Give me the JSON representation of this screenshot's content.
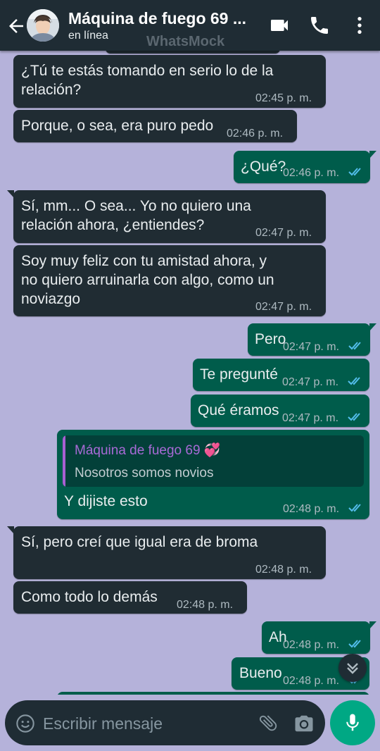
{
  "header": {
    "title": "Máquina de fuego 69 ...",
    "status": "en línea",
    "watermark": "WhatsMock"
  },
  "messages": [
    {
      "direction": "in",
      "text_lines": [
        "¿Tú te estás tomando en serio lo de la",
        "relación?"
      ],
      "time": "02:45 p. m."
    },
    {
      "direction": "in",
      "text_lines": [
        "Porque, o sea, era puro pedo"
      ],
      "time": "02:46 p. m."
    },
    {
      "direction": "out",
      "text_lines": [
        "¿Qué?"
      ],
      "time": "02:46 p. m.",
      "status": "read"
    },
    {
      "direction": "in",
      "text_lines": [
        "Sí, mm... O sea... Yo no quiero una",
        "relación ahora, ¿entiendes?"
      ],
      "time": "02:47 p. m."
    },
    {
      "direction": "in",
      "text_lines": [
        "Soy muy feliz con tu amistad ahora, y",
        "no quiero arruinarla con algo, como un",
        "noviazgo"
      ],
      "time": "02:47 p. m."
    },
    {
      "direction": "out",
      "text_lines": [
        "Pero"
      ],
      "time": "02:47 p. m.",
      "status": "read"
    },
    {
      "direction": "out",
      "text_lines": [
        "Te pregunté"
      ],
      "time": "02:47 p. m.",
      "status": "read"
    },
    {
      "direction": "out",
      "text_lines": [
        "Qué éramos"
      ],
      "time": "02:47 p. m.",
      "status": "read"
    },
    {
      "direction": "out",
      "quote": {
        "author": "Máquina de fuego 69",
        "author_emoji": "💞",
        "text": "Nosotros somos novios"
      },
      "text_lines": [
        "Y dijiste esto"
      ],
      "time": "02:48 p. m.",
      "status": "read"
    },
    {
      "direction": "in",
      "text_lines": [
        "Sí, pero creí que igual era de broma"
      ],
      "time": "02:48 p. m."
    },
    {
      "direction": "in",
      "text_lines": [
        "Como todo lo demás"
      ],
      "time": "02:48 p. m."
    },
    {
      "direction": "out",
      "text_lines": [
        "Ah"
      ],
      "time": "02:48 p. m.",
      "status": "read"
    },
    {
      "direction": "out",
      "text_lines": [
        "Bueno"
      ],
      "time": "02:48 p. m.",
      "status": "read"
    }
  ],
  "composer": {
    "placeholder": "Escribir mensaje"
  },
  "icons": {
    "back": "arrow-back-icon",
    "video": "video-call-icon",
    "call": "phone-icon",
    "menu": "more-vert-icon",
    "emoji": "emoji-icon",
    "attach": "paperclip-icon",
    "camera": "camera-icon",
    "mic": "mic-icon",
    "scroll": "double-chevron-down-icon"
  },
  "colors": {
    "chat_background": "#b5b2da",
    "header": "#1f2c34",
    "incoming_bubble": "#202c33",
    "outgoing_bubble": "#005c4b",
    "read_ticks": "#53bdeb",
    "mic_button": "#00a884",
    "quote_author": "#a86ad6"
  }
}
